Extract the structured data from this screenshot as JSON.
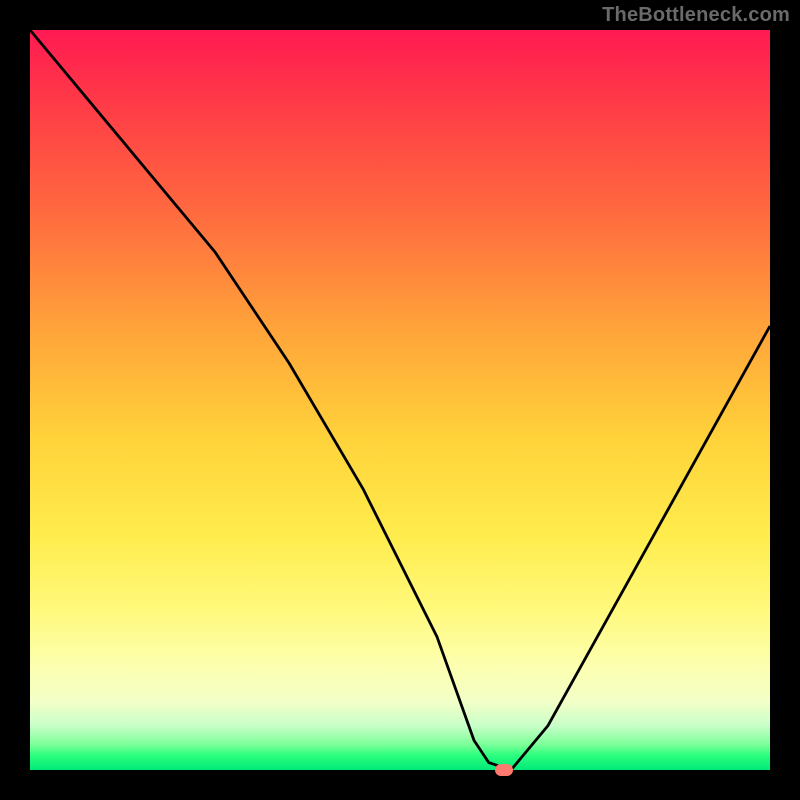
{
  "watermark": "TheBottleneck.com",
  "chart_data": {
    "type": "line",
    "title": "",
    "xlabel": "",
    "ylabel": "",
    "xlim": [
      0,
      100
    ],
    "ylim": [
      0,
      100
    ],
    "grid": false,
    "legend": false,
    "background": {
      "type": "vertical-gradient",
      "meaning": "bottleneck severity (red high, green low)",
      "stops": [
        {
          "pct": 0,
          "color": "#ff1a52"
        },
        {
          "pct": 25,
          "color": "#ff6b3f"
        },
        {
          "pct": 55,
          "color": "#ffd23a"
        },
        {
          "pct": 78,
          "color": "#fff97a"
        },
        {
          "pct": 94,
          "color": "#c8ffc8"
        },
        {
          "pct": 100,
          "color": "#00e97a"
        }
      ]
    },
    "series": [
      {
        "name": "bottleneck-curve",
        "x": [
          0,
          10,
          20,
          25,
          35,
          45,
          55,
          60,
          62,
          65,
          70,
          80,
          90,
          100
        ],
        "y": [
          100,
          88,
          76,
          70,
          55,
          38,
          18,
          4,
          1,
          0,
          6,
          24,
          42,
          60
        ]
      }
    ],
    "marker": {
      "name": "current-config",
      "x": 64,
      "y": 0,
      "color": "#ff7a6e"
    }
  }
}
